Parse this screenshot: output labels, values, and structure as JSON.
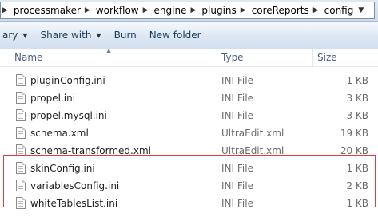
{
  "address": {
    "segments": [
      "processmaker",
      "workflow",
      "engine",
      "plugins",
      "coreReports",
      "config"
    ]
  },
  "toolbar": {
    "library_label": "ary",
    "share_label": "Share with",
    "burn_label": "Burn",
    "new_folder_label": "New folder"
  },
  "columns": {
    "name": "Name",
    "type": "Type",
    "size": "Size"
  },
  "files": [
    {
      "name": "pluginConfig.ini",
      "type": "INI File",
      "size": "1 KB"
    },
    {
      "name": "propel.ini",
      "type": "INI File",
      "size": "3 KB"
    },
    {
      "name": "propel.mysql.ini",
      "type": "INI File",
      "size": "3 KB"
    },
    {
      "name": "schema.xml",
      "type": "UltraEdit.xml",
      "size": "19 KB"
    },
    {
      "name": "schema-transformed.xml",
      "type": "UltraEdit.xml",
      "size": "20 KB"
    },
    {
      "name": "skinConfig.ini",
      "type": "INI File",
      "size": "1 KB"
    },
    {
      "name": "variablesConfig.ini",
      "type": "INI File",
      "size": "2 KB"
    },
    {
      "name": "whiteTablesList.ini",
      "type": "INI File",
      "size": "1 KB"
    }
  ],
  "colors": {
    "highlight": "#e23b3b",
    "toolbar_text": "#1e395b",
    "header_text": "#4c607a"
  },
  "icons": {
    "file": "document-icon",
    "separator": "chevron-right-icon",
    "dropdown": "chevron-down-icon"
  }
}
